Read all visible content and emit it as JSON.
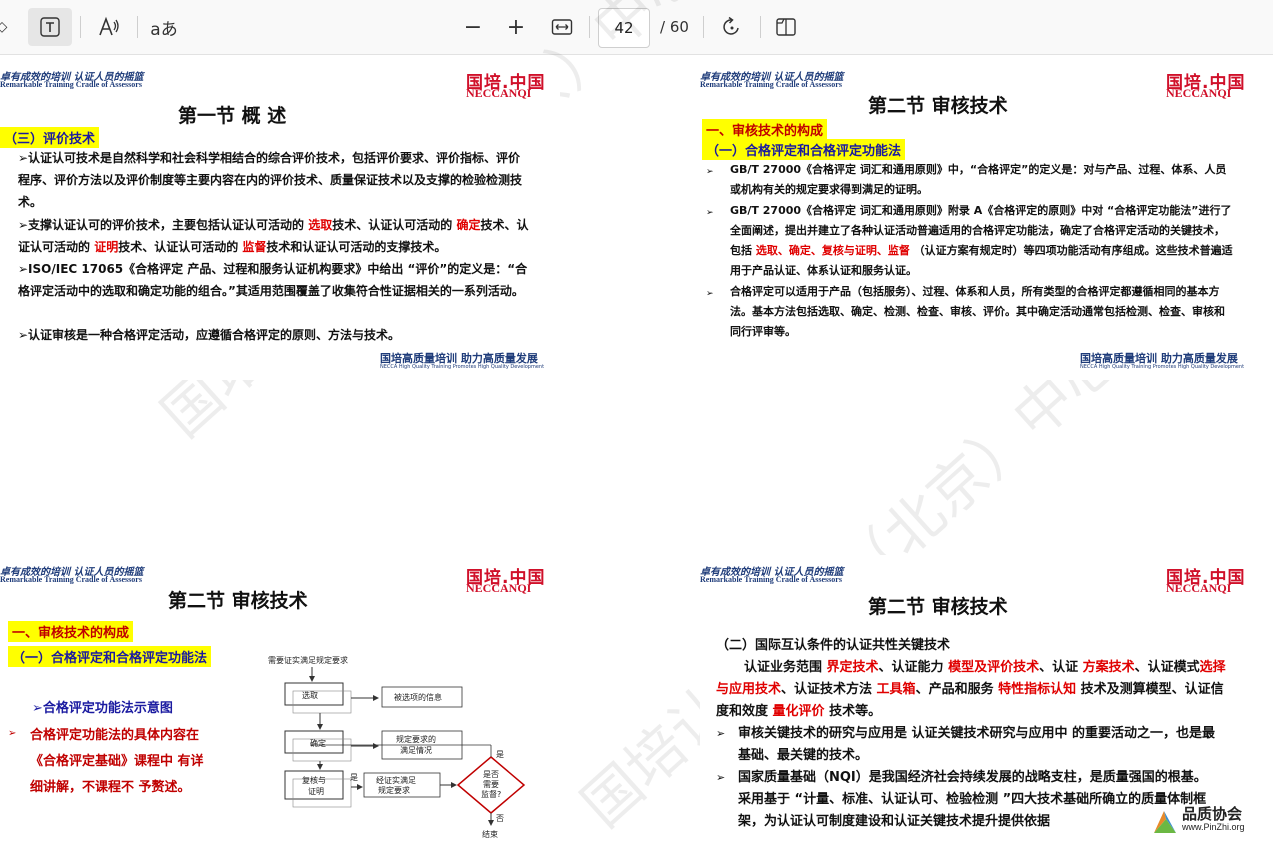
{
  "toolbar": {
    "text_tool_icon": "text-select-icon",
    "read_aloud_icon": "read-aloud-icon",
    "translate_label": "aあ",
    "zoom_out": "−",
    "zoom_in": "+",
    "fit_icon": "fit-width-icon",
    "page_current": "42",
    "page_total": "/ 60",
    "rotate_icon": "rotate-icon",
    "two_page_icon": "two-page-icon"
  },
  "common": {
    "slogan_cn": "卓有成效的培训  认证人员的摇篮",
    "slogan_en": "Remarkable Training   Cradle of Assessors",
    "logo_cn": "国培.中国",
    "logo_en": "NECCANQI",
    "footer_cn": "国培高质量培训  助力高质量发展",
    "footer_en": "NECCA High Quality Training Promotes High Quality Development"
  },
  "watermark": {
    "a": "国培认证培训（北京）中心",
    "b": "国培认证培训（北京）中心"
  },
  "slide1": {
    "title": "第一节    概    述",
    "section": "（三）评价技术",
    "p1": "➢认证认可技术是自然科学和社会科学相结合的综合评价技术，包括评价要求、评价指标、评价程序、评价方法以及评价制度等主要内容在内的评价技术、质量保证技术以及支撑的检验检测技术。",
    "p2a": "➢支撑认证认可的评价技术，主要包括认证认可活动的 ",
    "p2r1": "选取",
    "p2b": "技术、认证认可活动的 ",
    "p2r2": "确定",
    "p2c": "技术、认证认可活动的 ",
    "p2r3": "证明",
    "p2d": "技术、认证认可活动的 ",
    "p2r4": "监督",
    "p2e": "技术和认证认可活动的支撑技术。",
    "p3": "➢ISO/IEC 17065《合格评定 产品、过程和服务认证机构要求》中给出 “评价”的定义是：“合格评定活动中的选取和确定功能的组合。”其适用范围覆盖了收集符合性证据相关的一系列活动。",
    "p4": "➢认证审核是一种合格评定活动，应遵循合格评定的原则、方法与技术。"
  },
  "slide2": {
    "title": "第二节    审核技术",
    "h1": "一、审核技术的构成",
    "h2": "（一）合格评定和合格评定功能法",
    "b1": "GB/T 27000《合格评定 词汇和通用原则》中，“合格评定”的定义是：对与产品、过程、体系、人员或机构有关的规定要求得到满足的证明。",
    "b2a": "GB/T 27000《合格评定 词汇和通用原则》附录 A《合格评定的原则》中对 “合格评定功能法”进行了全面阐述，提出并建立了各种认证活动普遍适用的合格评定功能法，确定了合格评定活动的关键技术，包括 ",
    "b2r": "选取、确定、复核与证明、监督",
    "b2b": " （认证方案有规定时）等四项功能活动有序组成。这些技术普遍适用于产品认证、体系认证和服务认证。",
    "b3": "合格评定可以适用于产品（包括服务）、过程、体系和人员，所有类型的合格评定都遵循相同的基本方法。基本方法包括选取、确定、检测、检查、审核、评价。其中确定活动通常包括检测、检查、审核和同行评审等。"
  },
  "slide3": {
    "title": "第二节    审核技术",
    "h1": "一、审核技术的构成",
    "h2": "（一）合格评定和合格评定功能法",
    "item1": "➢合格评定功能法示意图",
    "item2a": "合格评定功能法的具体内容在",
    "item2b": "《合格评定基础》课程中 有详",
    "item2c": "细讲解，不课程不 予赘述。",
    "flow": {
      "top": "需要证实满足规定要求",
      "select": "选取",
      "select_out": "被选项的信息",
      "determine": "确定",
      "determine_out1": "规定要求的",
      "determine_out2": "满足情况",
      "review1": "复核与",
      "review2": "证明",
      "yes1": "是",
      "review_out1": "经证实满足",
      "review_out2": "规定要求",
      "diamond1": "是否",
      "diamond2": "需要",
      "diamond3": "监督?",
      "yes2": "是",
      "no": "否",
      "end": "结束"
    }
  },
  "slide4": {
    "title": "第二节    审核技术",
    "h": "（二）国际互认条件的认证共性关键技术",
    "p1a": "认证业务范围 ",
    "p1r1": "界定技术",
    "p1b": "、认证能力 ",
    "p1r2": "模型及评价技术",
    "p1c": "、认证 ",
    "p1r3": "方案技术",
    "p1d": "、认证模式",
    "p1r4": "选择与应用技术",
    "p1e": "、认证技术方法 ",
    "p1r5": "工具箱",
    "p1f": "、产品和服务 ",
    "p1r6": "特性指标认知",
    "p1g": " 技术及测算模型、认证信度和效度 ",
    "p1r7": "量化评价",
    "p1h": " 技术等。",
    "b1": "审核关键技术的研究与应用是 认证关键技术研究与应用中 的重要活动之一，也是最基础、最关键的技术。",
    "b2": "国家质量基础（NQI）是我国经济社会持续发展的战略支柱，是质量强国的根基。采用基于 “计量、标准、认证认可、检验检测 ”四大技术基础所确立的质量体制框架，为认证认可制度建设和认证关键技术提升提供依据",
    "badge_cn": "品质协会",
    "badge_en": "www.PinZhi.org"
  }
}
